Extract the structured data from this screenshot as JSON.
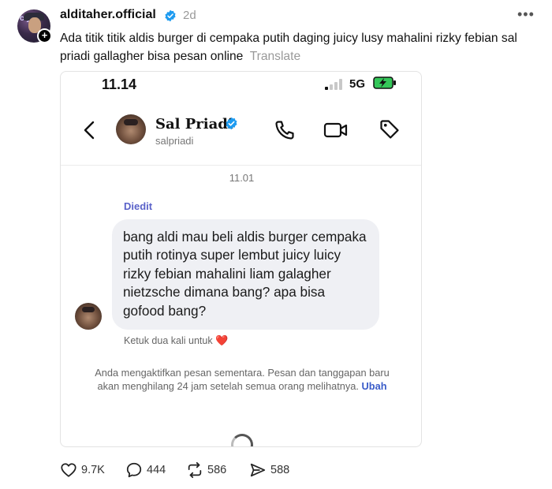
{
  "post": {
    "username": "alditaher.official",
    "time": "2d",
    "more_icon": "more-dots-icon",
    "caption": "Ada titik titik aldis burger di cempaka putih daging juicy lusy mahalini rizky febian sal priadi gallagher bisa pesan online",
    "translate_label": "Translate",
    "avatar_text": "cly",
    "follow_badge": "+"
  },
  "phone": {
    "status_time": "11.14",
    "network": "5G",
    "contact": {
      "name": "Sal Priadi",
      "handle": "salpriadi"
    },
    "message_time": "11.01",
    "edited_label": "Diedit",
    "message_text": "bang aldi mau beli aldis burger cempaka putih rotinya super lembut juicy luicy rizky febian mahalini liam galagher nietzsche dimana bang? apa bisa gofood bang?",
    "reaction_hint": "Ketuk dua kali untuk",
    "reaction_emoji": "❤️",
    "notice_text": "Anda mengaktifkan pesan sementara. Pesan dan tanggapan baru akan menghilang 24 jam setelah semua orang melihatnya.",
    "notice_link": "Ubah"
  },
  "actions": {
    "likes": "9.7K",
    "comments": "444",
    "reposts": "586",
    "shares": "588"
  },
  "colors": {
    "verified_blue": "#1d9bf0",
    "edited_purple": "#5a62c9",
    "bubble_bg": "#eff0f4",
    "battery_green": "#34c759"
  }
}
